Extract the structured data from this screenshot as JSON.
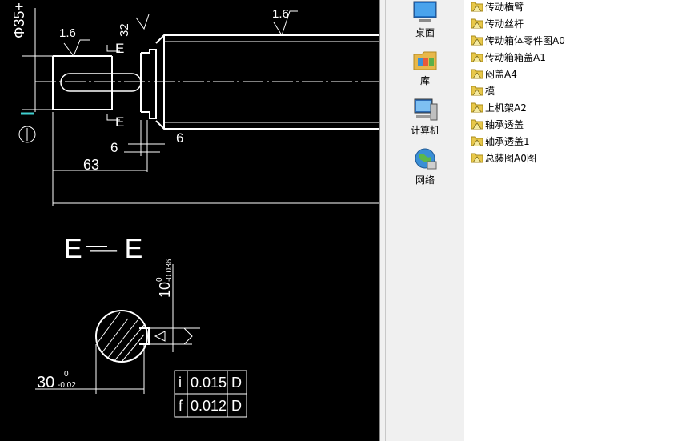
{
  "drawing": {
    "dims": {
      "roughness_top": "1.6",
      "roughness_left": "1.6",
      "roughness_32": "32",
      "dia_partial": "Φ35+",
      "dim_6_a": "6",
      "dim_6_b": "6",
      "dim_63": "63",
      "section_label": "E — E",
      "section_mark_top": "E",
      "section_mark_bottom": "E",
      "dim_10_main": "10",
      "dim_10_tol": "-0.036",
      "dim_10_tol0": "0",
      "dim_30_main": "30",
      "dim_30_tol": "-0.02",
      "dim_30_tol0": "0"
    },
    "tolerance_table": [
      {
        "symbol": "i",
        "value": "0.015",
        "datum": "D"
      },
      {
        "symbol": "f",
        "value": "0.012",
        "datum": "D"
      }
    ],
    "colors": {
      "bg": "#000000",
      "line": "#ffffff",
      "accent": "#3fd0d0"
    }
  },
  "nav": {
    "items": [
      {
        "label": "桌面",
        "icon": "desktop-icon"
      },
      {
        "label": "库",
        "icon": "library-icon"
      },
      {
        "label": "计算机",
        "icon": "computer-icon"
      },
      {
        "label": "网络",
        "icon": "network-icon"
      }
    ]
  },
  "files": {
    "icon": "cad-file-icon",
    "items": [
      "传动横臂",
      "传动丝杆",
      "传动箱体零件图A0",
      "传动箱箱盖A1",
      "闷盖A4",
      "模",
      "上机架A2",
      "轴承透盖",
      "轴承透盖1",
      "总装图A0图"
    ]
  }
}
